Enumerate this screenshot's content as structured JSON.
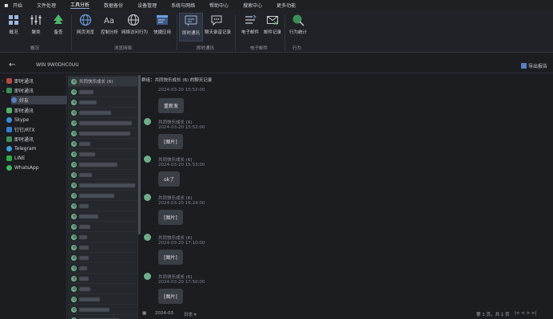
{
  "menu": [
    "开始",
    "文件处理",
    "工具分析",
    "数据备份",
    "设备管理",
    "系统与网络",
    "帮助中心",
    "搜索中心",
    "更多功能"
  ],
  "ribbon": {
    "buttons": [
      "概况",
      "聚类",
      "备查",
      "网页浏览",
      "控制分析",
      "网络访问行为",
      "快捷应用",
      "即时通讯",
      "聊天录音记录",
      "电子邮件",
      "邮件记录",
      "行为统计"
    ],
    "groups": [
      "概况",
      "浏览网络",
      "即时通讯",
      "电子邮件",
      "行为"
    ]
  },
  "title": {
    "back": "←",
    "device": "WIN 9W0DHC0UU",
    "export": "导出报告"
  },
  "tree": {
    "items": [
      "即时通讯",
      "即时通讯",
      "好友",
      "即时通讯",
      "Skype",
      "钉钉/RTX",
      "即时通讯",
      "Telegram",
      "LINE",
      "WhatsApp"
    ]
  },
  "contacts": {
    "items": [
      "共同快乐成长 (6)",
      "1",
      "2",
      "3",
      "4 群聊群(1)",
      "5 (188)",
      "6",
      "7",
      "8 (500)",
      "9",
      "10 (4)",
      "11",
      "12",
      "13",
      "14",
      "15",
      "16",
      "17",
      "18",
      "19",
      "20",
      "21",
      "22",
      "23",
      "24"
    ]
  },
  "chat": {
    "header": "群组：共同快乐成长 (6) 的聊天记录",
    "messages": [
      {
        "sender": "",
        "time": "2024-03-20 15:52:00",
        "text": "重新发"
      },
      {
        "sender": "共同快乐成长 (6)",
        "time": "2024-03-20 15:52:00",
        "text": "[图片]"
      },
      {
        "sender": "共同快乐成长 (6)",
        "time": "2024-03-20 15:53:00",
        "text": "ok了"
      },
      {
        "sender": "共同快乐成长 (6)",
        "time": "2024-03-20 16:24:00",
        "text": "[图片]"
      },
      {
        "sender": "共同快乐成长 (6)",
        "time": "2024-03-20 17:10:00",
        "text": "[图片]"
      },
      {
        "sender": "共同快乐成长 (6)",
        "time": "2024-03-20 17:50:00",
        "text": "[图片]"
      }
    ]
  },
  "status": {
    "date": "2024-03",
    "filter": "日志 ▾",
    "pages": "第 1 页，共 1 页",
    "nav": "|<  <  >  >|"
  },
  "colors": {
    "accent": "#5b7ec2",
    "avatar": "#6fae8a",
    "bubble": "#3a3e45"
  }
}
